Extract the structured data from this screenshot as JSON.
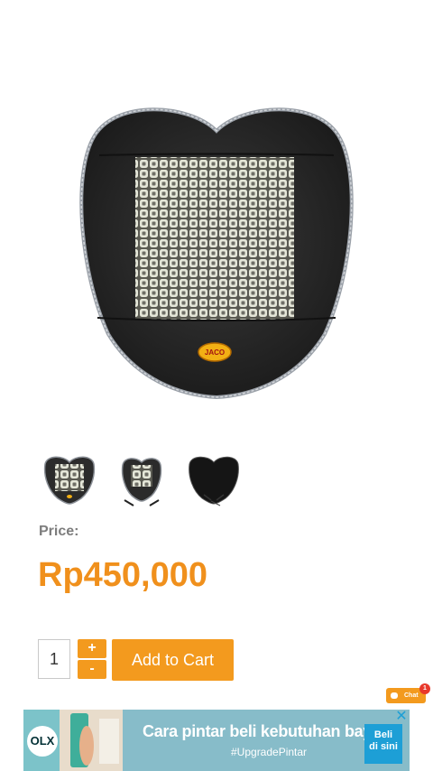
{
  "product": {
    "image_alt": "Jaco seat cushion",
    "brand_logo_text": "JACO",
    "price_label": "Price:",
    "price": "Rp450,000"
  },
  "thumbnails": [
    {
      "name": "front view"
    },
    {
      "name": "with straps"
    },
    {
      "name": "back view"
    }
  ],
  "cart": {
    "quantity": "1",
    "plus_label": "+",
    "minus_label": "-",
    "add_label": "Add to Cart"
  },
  "chat": {
    "label": "Chat",
    "badge": "1"
  },
  "ad": {
    "logo_text": "OLX",
    "headline": "Cara pintar beli kebutuhan bayi",
    "subline": "#UpgradePintar",
    "cta_line1": "Beli",
    "cta_line2": "di sini",
    "close_label": "✕"
  },
  "colors": {
    "accent": "#f39a1e",
    "price": "#f0901c",
    "ad_cta": "#1d9fd6"
  }
}
